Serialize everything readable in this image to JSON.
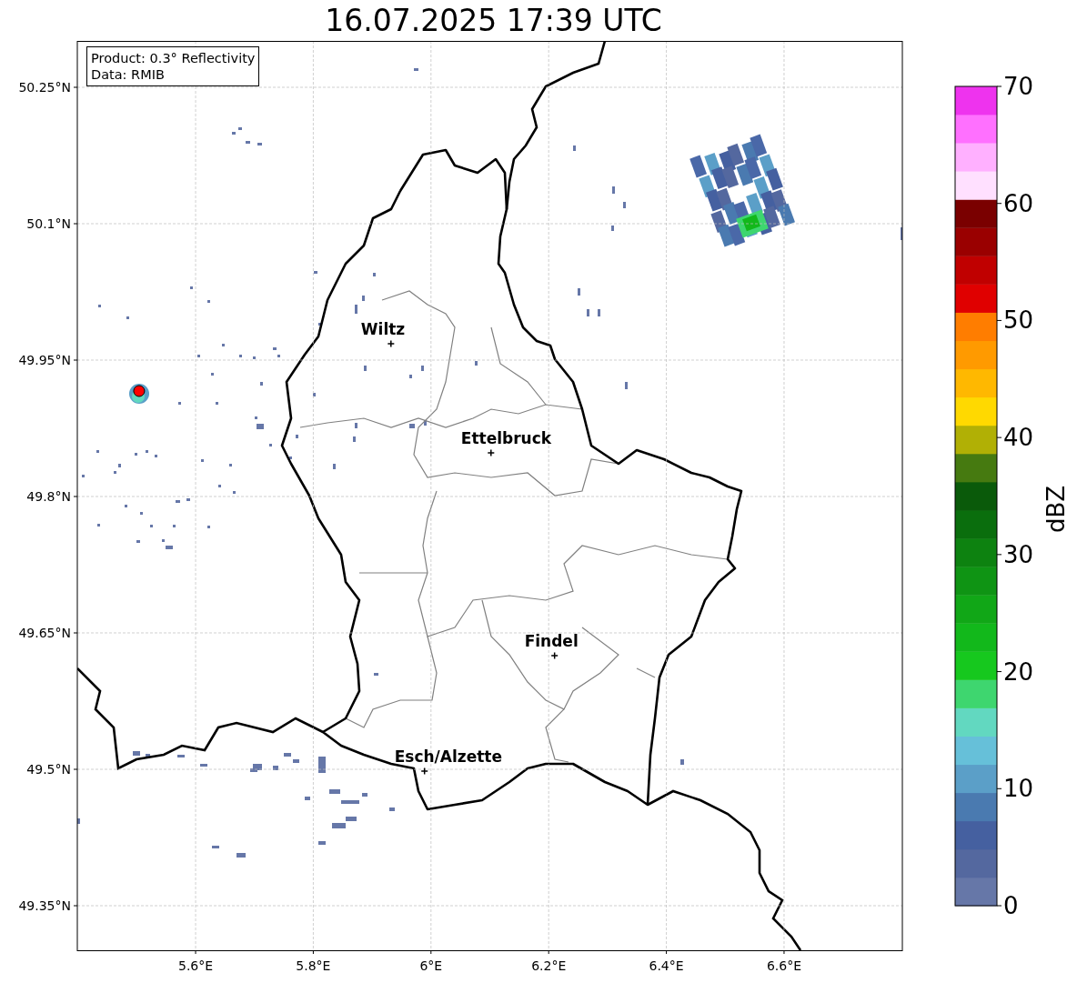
{
  "title": "16.07.2025 17:39 UTC",
  "info_box": [
    "Product: 0.3° Reflectivity",
    "Data: RMIB"
  ],
  "map": {
    "chart_data": {
      "type": "scatter",
      "grid": true,
      "xlim": [
        5.399,
        6.801
      ],
      "ylim": [
        49.301,
        50.301
      ],
      "xticks": [
        {
          "value": 5.6,
          "label": "5.6°E"
        },
        {
          "value": 5.8,
          "label": "5.8°E"
        },
        {
          "value": 6.0,
          "label": "6°E"
        },
        {
          "value": 6.2,
          "label": "6.2°E"
        },
        {
          "value": 6.4,
          "label": "6.4°E"
        },
        {
          "value": 6.6,
          "label": "6.6°E"
        }
      ],
      "yticks": [
        {
          "value": 50.25,
          "label": "50.25°N"
        },
        {
          "value": 50.1,
          "label": "50.1°N"
        },
        {
          "value": 49.95,
          "label": "49.95°N"
        },
        {
          "value": 49.8,
          "label": "49.8°N"
        },
        {
          "value": 49.65,
          "label": "49.65°N"
        },
        {
          "value": 49.5,
          "label": "49.5°N"
        },
        {
          "value": 49.35,
          "label": "49.35°N"
        }
      ],
      "series": [
        {
          "color": "#000000",
          "x": [
            5.932,
            6.102,
            6.21,
            5.989
          ],
          "values": [
            49.968,
            49.848,
            49.625,
            49.498
          ]
        },
        {
          "color": "#ff0000",
          "x": [
            5.504
          ],
          "values": [
            49.916
          ]
        }
      ],
      "annotations": [
        {
          "text": "Wiltz",
          "x": 5.932,
          "y": 49.968
        },
        {
          "text": "Ettelbruck",
          "x": 6.102,
          "y": 49.848
        },
        {
          "text": "Findel",
          "x": 6.21,
          "y": 49.625
        },
        {
          "text": "Esch/Alzette",
          "x": 5.989,
          "y": 49.498
        }
      ]
    }
  },
  "colorbar": {
    "label": "dBZ",
    "ticks": [
      "70",
      "60",
      "50",
      "40",
      "30",
      "20",
      "10",
      "0"
    ],
    "bins": [
      {
        "color": "#6677a8"
      },
      {
        "color": "#54689f"
      },
      {
        "color": "#4560a0"
      },
      {
        "color": "#4a7ab0"
      },
      {
        "color": "#5b9fc8"
      },
      {
        "color": "#66c0d9"
      },
      {
        "color": "#62d8c0"
      },
      {
        "color": "#3ed66f"
      },
      {
        "color": "#16c81e"
      },
      {
        "color": "#12b81b"
      },
      {
        "color": "#11a717"
      },
      {
        "color": "#0f9414"
      },
      {
        "color": "#0d8210"
      },
      {
        "color": "#0a6e0d"
      },
      {
        "color": "#0a5a0a"
      },
      {
        "color": "#467a10"
      },
      {
        "color": "#b1b005"
      },
      {
        "color": "#ffd900"
      },
      {
        "color": "#ffb800"
      },
      {
        "color": "#ff9a00"
      },
      {
        "color": "#ff7d00"
      },
      {
        "color": "#e00000"
      },
      {
        "color": "#c00000"
      },
      {
        "color": "#9a0000"
      },
      {
        "color": "#7a0000"
      },
      {
        "color": "#ffe0ff"
      },
      {
        "color": "#ffb0ff"
      },
      {
        "color": "#ff70ff"
      },
      {
        "color": "#ee33ee"
      }
    ]
  }
}
